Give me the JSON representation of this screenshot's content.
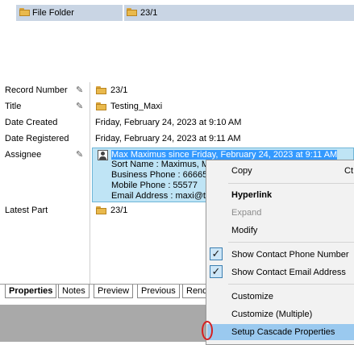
{
  "top_row": {
    "type_value": "File Folder",
    "number_value": "23/1"
  },
  "properties": {
    "record_number": {
      "label": "Record Number",
      "value": "23/1"
    },
    "title": {
      "label": "Title",
      "value": "Testing_Maxi"
    },
    "date_created": {
      "label": "Date Created",
      "value": "Friday, February 24, 2023 at 9:10 AM"
    },
    "date_registered": {
      "label": "Date Registered",
      "value": "Friday, February 24, 2023 at 9:11 AM"
    },
    "assignee": {
      "label": "Assignee",
      "lines": [
        "Max Maximus since Friday, February 24, 2023 at 9:11 AM",
        "Sort Name : Maximus, M",
        "Business Phone : 66665",
        "Mobile Phone : 55577",
        "Email Address : maxi@t"
      ]
    },
    "latest_part": {
      "label": "Latest Part",
      "value": "23/1"
    }
  },
  "tabs": [
    "Properties",
    "Notes",
    "Preview",
    "Previous",
    "Rend"
  ],
  "context_menu": {
    "copy": "Copy",
    "copy_shortcut": "Ct",
    "hyperlink": "Hyperlink",
    "expand": "Expand",
    "modify": "Modify",
    "show_phone": "Show Contact Phone Number",
    "show_email": "Show Contact Email Address",
    "customize": "Customize",
    "customize_multiple": "Customize (Multiple)",
    "setup_cascade": "Setup Cascade Properties"
  },
  "icons": {
    "folder": "folder-icon",
    "pencil": "pencil-icon",
    "contact": "contact-icon",
    "check": "checkmark-icon"
  },
  "colors": {
    "selection_blue": "#bfe4f5",
    "menu_hover": "#9ac9ef",
    "header_highlight": "#c9d5e4"
  }
}
